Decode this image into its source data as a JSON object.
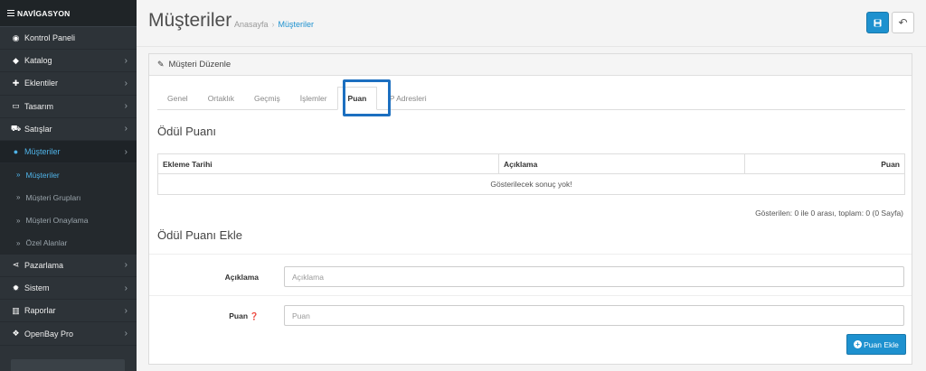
{
  "sidebar": {
    "header": "NAVİGASYON",
    "items": [
      {
        "icon": "dashboard-icon",
        "glyph": "◉",
        "label": "Kontrol Paneli",
        "chevron": false,
        "active": false
      },
      {
        "icon": "tag-icon",
        "glyph": "◆",
        "label": "Katalog",
        "chevron": true,
        "active": false
      },
      {
        "icon": "puzzle-icon",
        "glyph": "✚",
        "label": "Eklentiler",
        "chevron": true,
        "active": false
      },
      {
        "icon": "desktop-icon",
        "glyph": "▭",
        "label": "Tasarım",
        "chevron": true,
        "active": false
      },
      {
        "icon": "cart-icon",
        "glyph": "⛟",
        "label": "Satışlar",
        "chevron": true,
        "active": false
      },
      {
        "icon": "user-icon",
        "glyph": "●",
        "label": "Müşteriler",
        "chevron": true,
        "active": true
      }
    ],
    "subitems": [
      {
        "label": "Müşteriler",
        "active": true
      },
      {
        "label": "Müşteri Grupları",
        "active": false
      },
      {
        "label": "Müşteri Onaylama",
        "active": false
      },
      {
        "label": "Özel Alanlar",
        "active": false
      }
    ],
    "items2": [
      {
        "icon": "share-icon",
        "glyph": "⋖",
        "label": "Pazarlama",
        "chevron": true
      },
      {
        "icon": "cog-icon",
        "glyph": "✹",
        "label": "Sistem",
        "chevron": true
      },
      {
        "icon": "bar-chart-icon",
        "glyph": "▥",
        "label": "Raporlar",
        "chevron": true
      },
      {
        "icon": "cubes-icon",
        "glyph": "❖",
        "label": "OpenBay Pro",
        "chevron": true
      }
    ]
  },
  "header": {
    "title": "Müşteriler",
    "breadcrumb": [
      "Anasayfa",
      "Müşteriler"
    ],
    "separator": "›"
  },
  "panel": {
    "title": "Müşteri Düzenle",
    "tabs": [
      "Genel",
      "Ortaklık",
      "Geçmiş",
      "İşlemler",
      "Puan",
      "IP Adresleri"
    ],
    "active_tab": 4
  },
  "reward": {
    "title": "Ödül Puanı",
    "columns": [
      "Ekleme Tarihi",
      "Açıklama",
      "Puan"
    ],
    "empty_text": "Gösterilecek sonuç yok!",
    "summary": "Gösterilen: 0 ile 0 arası, toplam: 0 (0 Sayfa)"
  },
  "add_form": {
    "title": "Ödül Puanı Ekle",
    "description_label": "Açıklama",
    "description_placeholder": "Açıklama",
    "description_value": "",
    "points_label": "Puan",
    "points_placeholder": "Puan",
    "points_value": "",
    "add_button": "Puan Ekle"
  },
  "colors": {
    "primary": "#1e91cf",
    "sidebar_bg": "#2d3338",
    "active_link": "#4fb3e8",
    "highlight": "#1c6fc0"
  }
}
